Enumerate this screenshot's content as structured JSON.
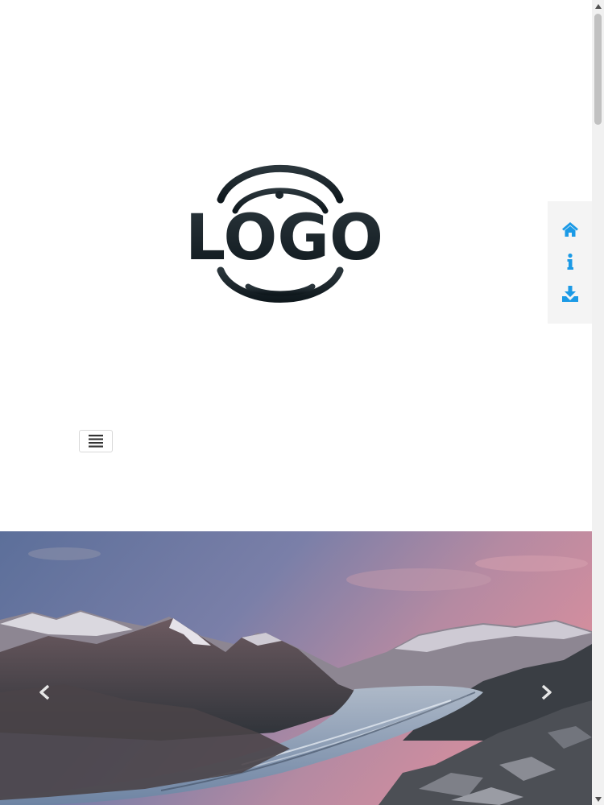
{
  "logo": {
    "text": "LOGO",
    "color": "#1c262c"
  },
  "navbar": {
    "toggle_icon": "hamburger-menu-icon"
  },
  "quickbar": {
    "accent": "#1b9ae6",
    "items": [
      {
        "icon": "home-icon"
      },
      {
        "icon": "info-icon"
      },
      {
        "icon": "download-icon"
      }
    ]
  },
  "carousel": {
    "prev_icon": "chevron-left-icon",
    "next_icon": "chevron-right-icon",
    "slide": "mountain-glacier-landscape"
  }
}
